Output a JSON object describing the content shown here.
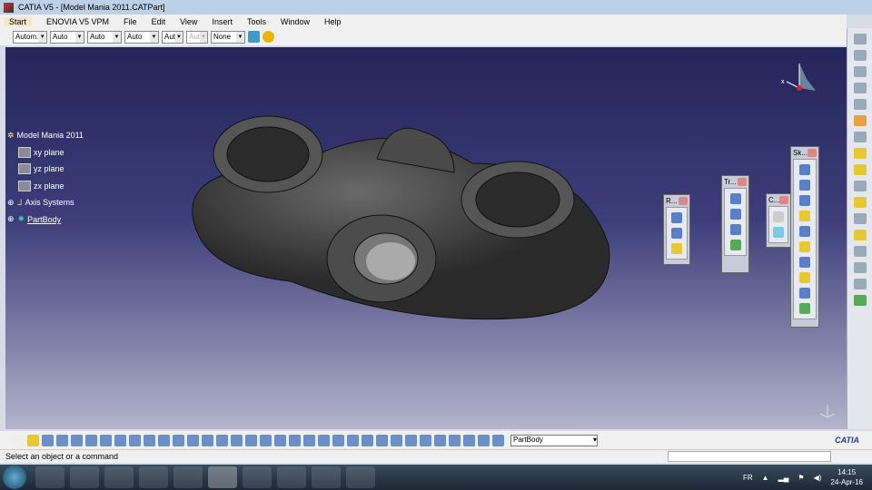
{
  "title": "CATIA V5 - [Model Mania 2011.CATPart]",
  "menu": [
    "Start",
    "ENOVIA V5 VPM",
    "File",
    "Edit",
    "View",
    "Insert",
    "Tools",
    "Window",
    "Help"
  ],
  "toolbar_dropdowns": [
    "Autom.",
    "Auto",
    "Auto",
    "Auto",
    "Aut",
    "Aut",
    "None"
  ],
  "tree": {
    "root": "Model Mania 2011",
    "items": [
      "xy plane",
      "yz plane",
      "zx plane",
      "Axis Systems",
      "PartBody"
    ]
  },
  "palettes": {
    "reference": "R...",
    "transform": "Tr...",
    "constraint": "C...",
    "sketch": "Sk..."
  },
  "bottom": {
    "current_body": "PartBody",
    "logo": "CATIA"
  },
  "status": "Select an object or a command",
  "tray": {
    "lang": "FR",
    "time": "14:15",
    "date": "24-Apr-16"
  }
}
